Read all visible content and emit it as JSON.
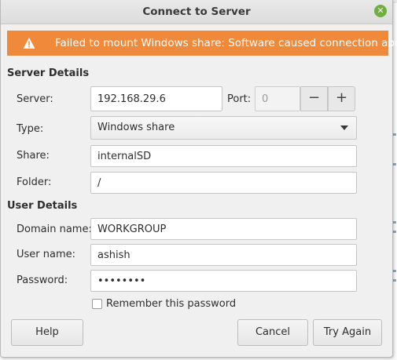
{
  "window": {
    "title": "Connect to Server"
  },
  "infobar": {
    "icon": "warning-icon",
    "message": "Failed to mount Windows share: Software caused connection abort",
    "color": "#f08a3a"
  },
  "server_details": {
    "heading": "Server Details",
    "server_label": "Server:",
    "server_value": "192.168.29.6",
    "port_label": "Port:",
    "port_value": "0",
    "decrement": "−",
    "increment": "+",
    "type_label": "Type:",
    "type_value": "Windows share",
    "share_label": "Share:",
    "share_value": "internalSD",
    "folder_label": "Folder:",
    "folder_value": "/"
  },
  "user_details": {
    "heading": "User Details",
    "domain_label": "Domain name:",
    "domain_value": "WORKGROUP",
    "user_label": "User name:",
    "user_value": "ashish",
    "password_label": "Password:",
    "password_value": "••••••••",
    "remember_label": "Remember this password",
    "remember_checked": false
  },
  "buttons": {
    "help": "Help",
    "cancel": "Cancel",
    "try_again": "Try Again"
  },
  "colors": {
    "accent_close": "#6fb03d",
    "warning": "#f08a3a"
  }
}
